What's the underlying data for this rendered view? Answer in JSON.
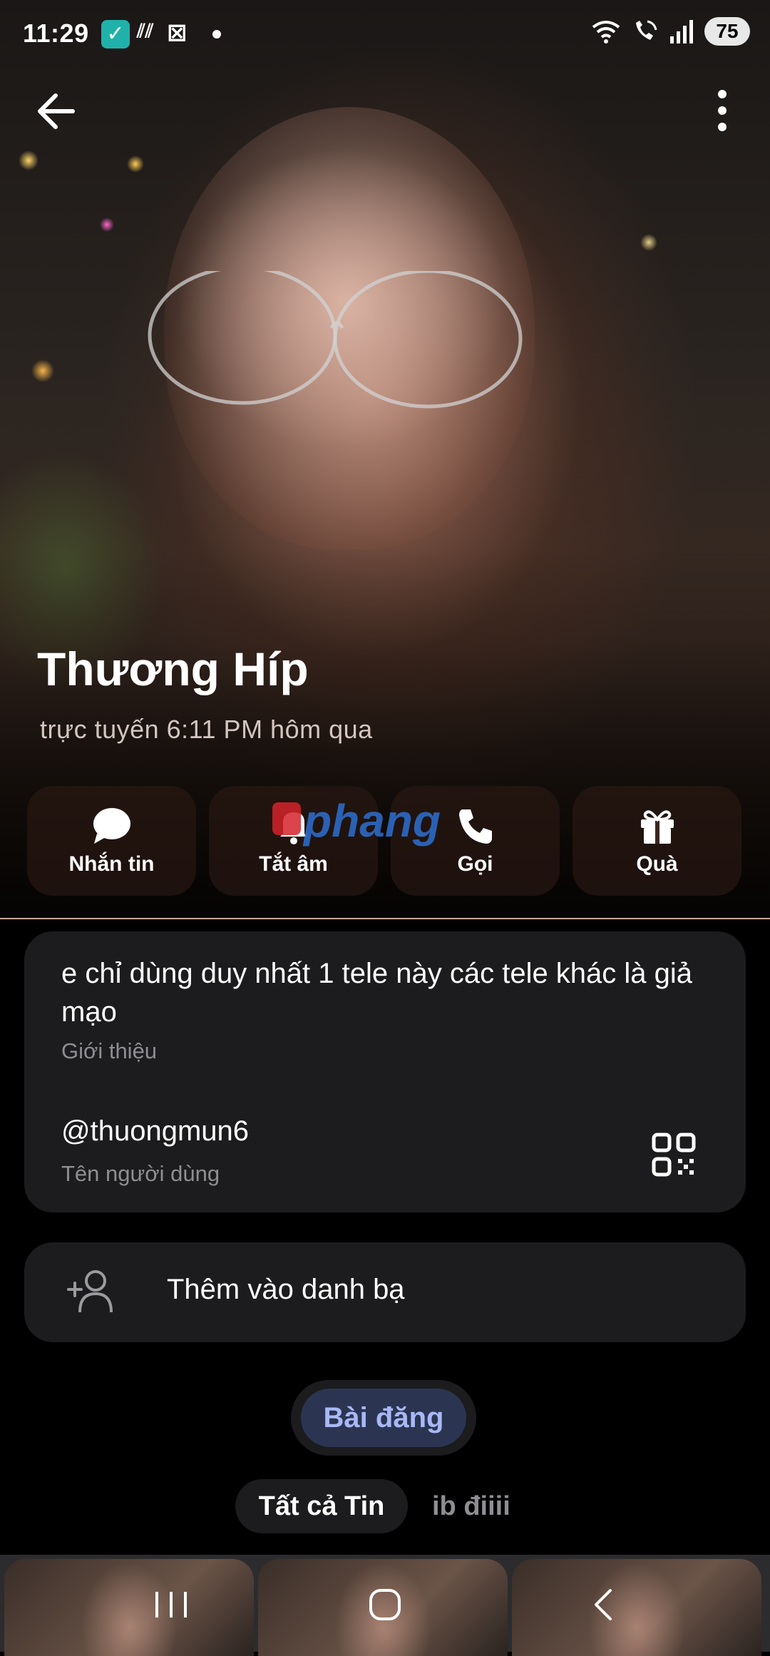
{
  "status_bar": {
    "time": "11:29",
    "battery": "75"
  },
  "profile": {
    "name": "Thương Híp",
    "last_seen": "trực tuyến 6:11 PM hôm qua"
  },
  "actions": [
    {
      "label": "Nhắn tin",
      "icon": "message-icon"
    },
    {
      "label": "Tắt âm",
      "icon": "mute-icon"
    },
    {
      "label": "Gọi",
      "icon": "phone-icon"
    },
    {
      "label": "Quà",
      "icon": "gift-icon"
    }
  ],
  "watermark": {
    "text": "phang"
  },
  "info": {
    "bio": "e chỉ dùng duy nhất 1 tele này các tele khác là giả mạo",
    "bio_caption": "Giới thiệu",
    "username": "@thuongmun6",
    "username_caption": "Tên người dùng"
  },
  "add_contact": {
    "label": "Thêm vào danh bạ"
  },
  "posts": {
    "pill_label": "Bài đăng",
    "tabs": [
      {
        "label": "Tất cả Tin",
        "selected": true
      },
      {
        "label": "ib điiii",
        "selected": false
      }
    ]
  },
  "colors": {
    "card_bg": "#1c1c1e",
    "accent_pill_bg": "#2b3552",
    "accent_pill_text": "#a9b8f5",
    "muted_text": "#8e8e93"
  }
}
